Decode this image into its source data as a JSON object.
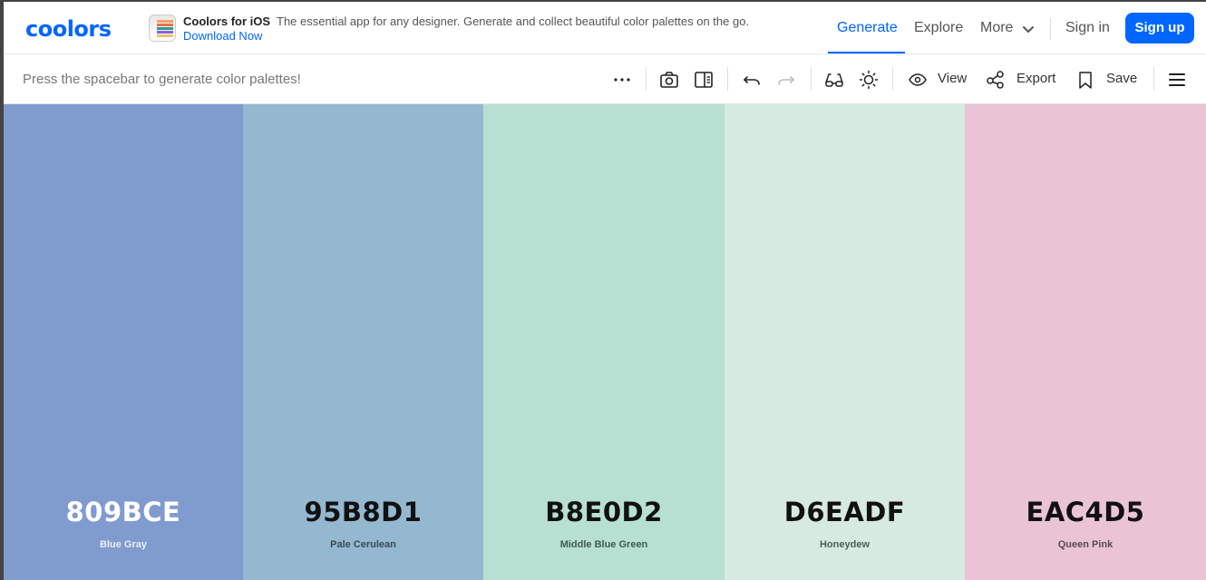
{
  "app": {
    "logo": "coolors"
  },
  "promo": {
    "title": "Coolors for iOS",
    "description": "The essential app for any designer. Generate and collect beautiful color palettes on the go.",
    "link": "Download Now"
  },
  "nav": {
    "generate": "Generate",
    "explore": "Explore",
    "more": "More",
    "signin": "Sign in",
    "signup": "Sign up"
  },
  "toolbar": {
    "hint": "Press the spacebar to generate color palettes!",
    "view": "View",
    "export": "Export",
    "save": "Save"
  },
  "colors": {
    "brand": "#0066ff"
  },
  "palette": [
    {
      "hex": "809BCE",
      "name": "Blue Gray",
      "color": "#809BCE",
      "text_color": "#ffffff",
      "name_color": "#e8eefa"
    },
    {
      "hex": "95B8D1",
      "name": "Pale Cerulean",
      "color": "#95B8D1",
      "text_color": "#111111",
      "name_color": "#3a4a55"
    },
    {
      "hex": "B8E0D2",
      "name": "Middle Blue Green",
      "color": "#B8E0D2",
      "text_color": "#111111",
      "name_color": "#3f5a52"
    },
    {
      "hex": "D6EADF",
      "name": "Honeydew",
      "color": "#D6EADF",
      "text_color": "#111111",
      "name_color": "#4e5e56"
    },
    {
      "hex": "EAC4D5",
      "name": "Queen Pink",
      "color": "#EAC4D5",
      "text_color": "#111111",
      "name_color": "#5a4a52"
    }
  ]
}
